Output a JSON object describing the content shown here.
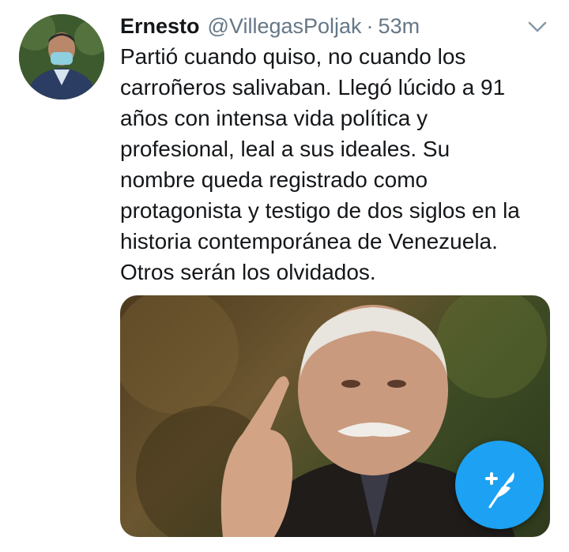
{
  "tweet": {
    "author_name": "Ernesto",
    "handle": "@VillegasPoljak",
    "separator": "·",
    "time": "53m",
    "text_lines": [
      "Partió cuando quiso, no cuando los",
      "carroñeros salivaban. Llegó lúcido a 91",
      "años con intensa vida política y",
      "profesional, leal a sus ideales. Su",
      "nombre queda registrado como",
      "protagonista y testigo de dos siglos en la",
      "historia contemporánea de Venezuela.",
      "Otros serán los olvidados."
    ]
  },
  "icons": {
    "more": "chevron-down-icon",
    "compose": "compose-feather-icon"
  },
  "colors": {
    "accent": "#1da1f2",
    "text": "#14171a",
    "secondary": "#657786"
  }
}
